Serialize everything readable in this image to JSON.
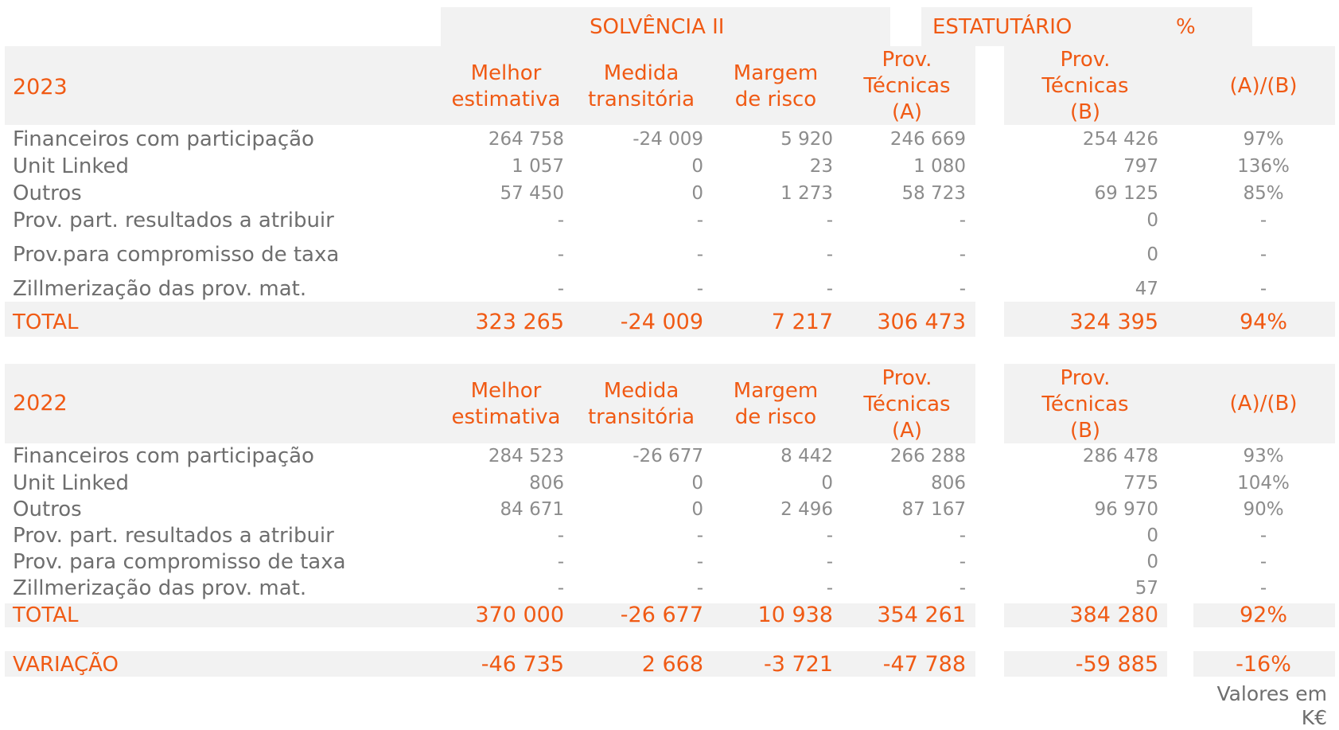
{
  "header": {
    "solvencia": "SOLVÊNCIA II",
    "estatutario": "ESTATUTÁRIO",
    "percent": "%"
  },
  "columns": {
    "melhor": [
      "Melhor",
      "estimativa"
    ],
    "medida": [
      "Medida",
      "transitória"
    ],
    "margem": [
      "Margem",
      "de risco"
    ],
    "provA": [
      "Prov.",
      "Técnicas",
      "(A)"
    ],
    "provB": [
      "Prov.",
      "Técnicas",
      "(B)"
    ],
    "ratio": "(A)/(B)"
  },
  "sections": [
    {
      "year": "2023",
      "rows": [
        {
          "label": "Financeiros com participação",
          "values": [
            "264 758",
            "-24 009",
            "5 920",
            "246 669",
            "254 426",
            "97%"
          ]
        },
        {
          "label": "Unit Linked",
          "values": [
            "1 057",
            "0",
            "23",
            "1 080",
            "797",
            "136%"
          ]
        },
        {
          "label": "Outros",
          "values": [
            "57 450",
            "0",
            "1 273",
            "58 723",
            "69 125",
            "85%"
          ]
        },
        {
          "label": "Prov. part. resultados a atribuir",
          "values": [
            "-",
            "-",
            "-",
            "-",
            "0",
            "-"
          ]
        },
        {
          "label": "Prov.para compromisso de taxa",
          "values": [
            "-",
            "-",
            "-",
            "-",
            "0",
            "-"
          ]
        },
        {
          "label": "Zillmerização das prov. mat.",
          "values": [
            "-",
            "-",
            "-",
            "-",
            "47",
            "-"
          ]
        }
      ],
      "total": {
        "label": "TOTAL",
        "values": [
          "323 265",
          "-24 009",
          "7 217",
          "306 473",
          "324 395",
          "94%"
        ]
      }
    },
    {
      "year": "2022",
      "rows": [
        {
          "label": "Financeiros com participação",
          "values": [
            "284 523",
            "-26 677",
            "8 442",
            "266 288",
            "286 478",
            "93%"
          ]
        },
        {
          "label": "Unit Linked",
          "values": [
            "806",
            "0",
            "0",
            "806",
            "775",
            "104%"
          ]
        },
        {
          "label": "Outros",
          "values": [
            "84 671",
            "0",
            "2 496",
            "87 167",
            "96 970",
            "90%"
          ]
        },
        {
          "label": "Prov. part. resultados a atribuir",
          "values": [
            "-",
            "-",
            "-",
            "-",
            "0",
            "-"
          ]
        },
        {
          "label": "Prov. para compromisso de taxa",
          "values": [
            "-",
            "-",
            "-",
            "-",
            "0",
            "-"
          ]
        },
        {
          "label": "Zillmerização das prov. mat.",
          "values": [
            "-",
            "-",
            "-",
            "-",
            "57",
            "-"
          ]
        }
      ],
      "total": {
        "label": "TOTAL",
        "values": [
          "370 000",
          "-26 677",
          "10 938",
          "354 261",
          "384 280",
          "92%"
        ]
      }
    }
  ],
  "variacao": {
    "label": "VARIAÇÃO",
    "values": [
      "-46 735",
      "2 668",
      "-3 721",
      "-47 788",
      "-59 885",
      "-16%"
    ]
  },
  "footnote": [
    "Valores em",
    "K€"
  ]
}
